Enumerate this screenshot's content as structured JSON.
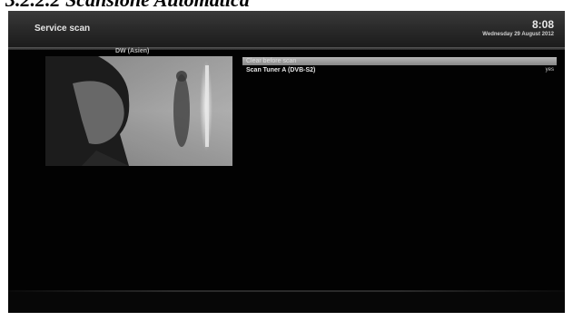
{
  "document": {
    "heading": "3.2.2.2 Scansione Automatica"
  },
  "screen": {
    "title": "Service scan",
    "clock": "8:08",
    "date": "Wednesday 29 August 2012"
  },
  "preview": {
    "channel_name": "DW (Asien)"
  },
  "menu": {
    "items": [
      {
        "label": "Clear before scan",
        "value": "",
        "selected": true
      },
      {
        "label": "Scan Tuner A (DVB-S2)",
        "value": "yes",
        "selected": false
      }
    ]
  },
  "colors": {
    "screen_background": "#020202",
    "header_top": "#3a3a3a",
    "selection_bar": "#a0a0a0"
  },
  "icons": []
}
